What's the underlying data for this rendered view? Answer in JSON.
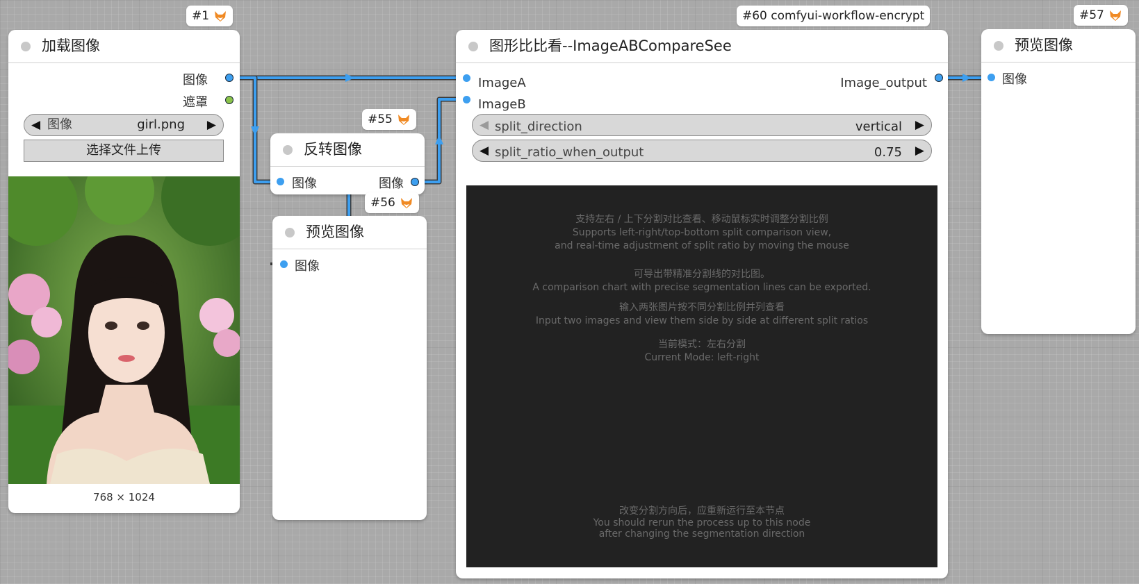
{
  "links_color": "#3d9ff0",
  "nodes": {
    "load_image": {
      "badge": "#1",
      "title": "加载图像",
      "outputs": [
        "图像",
        "遮罩"
      ],
      "widget": {
        "label": "图像",
        "value": "girl.png"
      },
      "upload_button": "选择文件上传",
      "image_size": "768 × 1024"
    },
    "invert_image": {
      "badge": "#55",
      "title": "反转图像",
      "input": "图像",
      "output": "图像"
    },
    "preview_56": {
      "badge": "#56",
      "title": "预览图像",
      "input": "图像"
    },
    "compare": {
      "badge": "#60 comfyui-workflow-encrypt",
      "title": "图形比比看--ImageABCompareSee",
      "inputs": [
        "ImageA",
        "ImageB"
      ],
      "output": "Image_output",
      "widgets": [
        {
          "label": "split_direction",
          "value": "vertical"
        },
        {
          "label": "split_ratio_when_output",
          "value": "0.75"
        }
      ],
      "canvas_text": [
        "支持左右 / 上下分割对比查看、移动鼠标实时调整分割比例",
        "Supports left-right/top-bottom split comparison view,",
        "and real-time adjustment of split ratio by moving the mouse",
        "可导出带精准分割线的对比图。",
        "A comparison chart with precise segmentation lines can be exported.",
        "输入两张图片按不同分割比例并列查看",
        "Input two images and view them side by side at different split ratios",
        "当前模式：左右分割",
        "Current Mode: left-right",
        "改变分割方向后，应重新运行至本节点",
        "You should rerun the process up to this node",
        "after changing the segmentation direction"
      ]
    },
    "preview_57": {
      "badge": "#57",
      "title": "预览图像",
      "input": "图像"
    }
  }
}
